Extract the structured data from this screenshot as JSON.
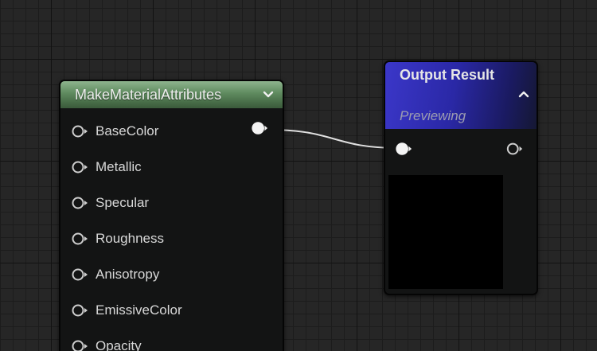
{
  "make_node": {
    "title": "MakeMaterialAttributes",
    "pins": [
      {
        "label": "BaseColor",
        "connected": true
      },
      {
        "label": "Metallic",
        "connected": false
      },
      {
        "label": "Specular",
        "connected": false
      },
      {
        "label": "Roughness",
        "connected": false
      },
      {
        "label": "Anisotropy",
        "connected": false
      },
      {
        "label": "EmissiveColor",
        "connected": false
      },
      {
        "label": "Opacity",
        "connected": false
      }
    ]
  },
  "output_node": {
    "title": "Output Result",
    "subtitle": "Previewing"
  },
  "colors": {
    "grid_background": "#262626",
    "make_header": "#5e8a5e",
    "output_header": "#2a28a6",
    "wire": "#e0e0e0"
  },
  "icons": {
    "expand": "chevron-down-icon",
    "collapse": "chevron-up-icon",
    "pin": "pin-icon"
  }
}
